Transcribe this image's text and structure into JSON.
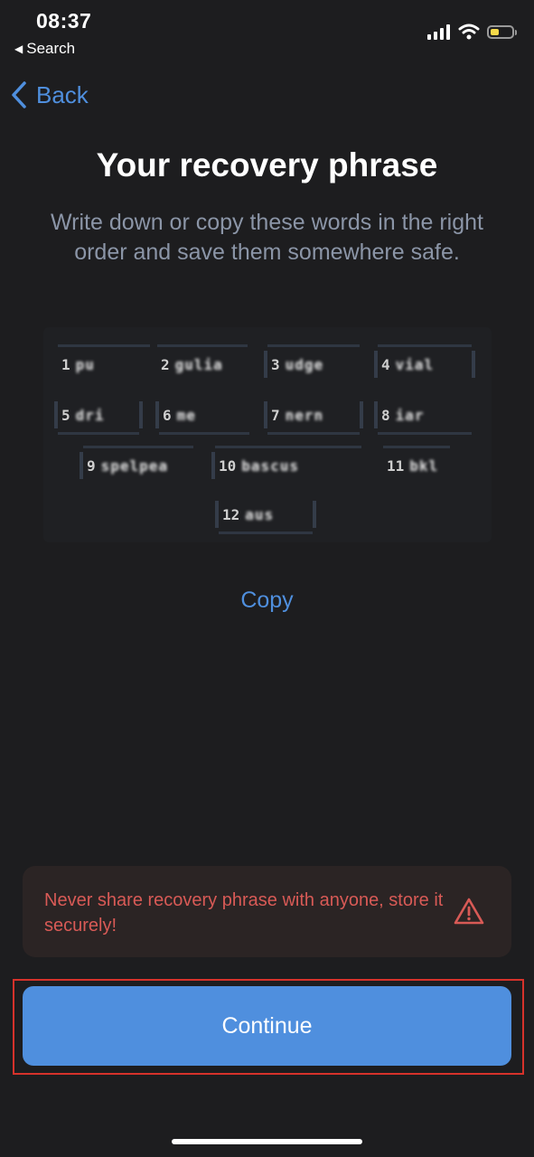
{
  "status": {
    "time": "08:37",
    "back_app": "Search",
    "icons": [
      "cellular-signal-icon",
      "wifi-icon",
      "battery-icon"
    ]
  },
  "nav": {
    "back_label": "Back"
  },
  "title": "Your recovery phrase",
  "subtitle": "Write down or copy these words in the right order and save them somewhere safe.",
  "words": [
    {
      "n": "1",
      "w": "pu"
    },
    {
      "n": "2",
      "w": "gulia"
    },
    {
      "n": "3",
      "w": "udge"
    },
    {
      "n": "4",
      "w": "vial"
    },
    {
      "n": "5",
      "w": "dri"
    },
    {
      "n": "6",
      "w": "me"
    },
    {
      "n": "7",
      "w": "nern"
    },
    {
      "n": "8",
      "w": "iar"
    },
    {
      "n": "9",
      "w": "spelpea"
    },
    {
      "n": "10",
      "w": "bascus"
    },
    {
      "n": "11",
      "w": "bkl"
    },
    {
      "n": "12",
      "w": "aus"
    }
  ],
  "copy_label": "Copy",
  "warning": {
    "text": "Never share recovery phrase with anyone, store it securely!",
    "icon": "warning-triangle-icon"
  },
  "continue_label": "Continue",
  "colors": {
    "background": "#1d1d1f",
    "accent": "#4f8fde",
    "warning_text": "#d85a56",
    "warning_bg": "#2b2424",
    "highlight_border": "#d6322b"
  }
}
